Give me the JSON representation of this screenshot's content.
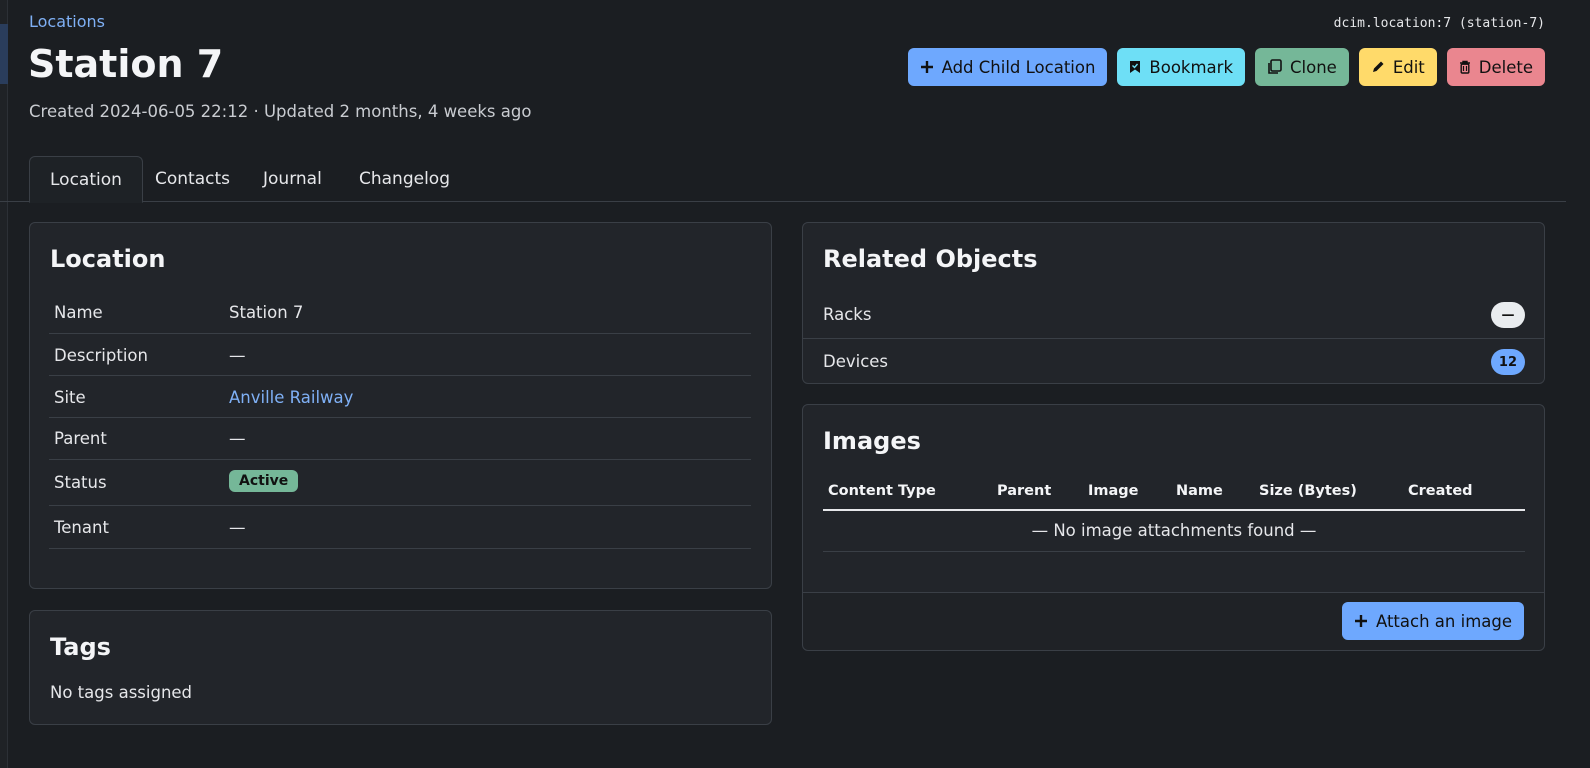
{
  "breadcrumb": "Locations",
  "object_id": "dcim.location:7 (station-7)",
  "title": "Station 7",
  "meta": "Created 2024-06-05 22:12 · Updated 2 months, 4 weeks ago",
  "actions": {
    "add_child": "Add Child Location",
    "bookmark": "Bookmark",
    "clone": "Clone",
    "edit": "Edit",
    "delete": "Delete"
  },
  "tabs": [
    "Location",
    "Contacts",
    "Journal",
    "Changelog"
  ],
  "location_card": {
    "title": "Location",
    "rows": [
      {
        "key": "Name",
        "value": "Station 7"
      },
      {
        "key": "Description",
        "value": "—"
      },
      {
        "key": "Site",
        "value": "Anville Railway"
      },
      {
        "key": "Parent",
        "value": "—"
      },
      {
        "key": "Status",
        "value": "Active"
      },
      {
        "key": "Tenant",
        "value": "—"
      }
    ]
  },
  "tags_card": {
    "title": "Tags",
    "empty": "No tags assigned"
  },
  "related_card": {
    "title": "Related Objects",
    "rows": [
      {
        "label": "Racks",
        "count": "—"
      },
      {
        "label": "Devices",
        "count": "12"
      }
    ]
  },
  "images_card": {
    "title": "Images",
    "columns": [
      "Content Type",
      "Parent",
      "Image",
      "Name",
      "Size (Bytes)",
      "Created"
    ],
    "empty": "— No image attachments found —",
    "attach_label": "Attach an image"
  },
  "colors": {
    "primary": "#6ea8fe",
    "info": "#6edff6",
    "success": "#75b798",
    "warning": "#ffda6a",
    "danger": "#ea868f"
  }
}
